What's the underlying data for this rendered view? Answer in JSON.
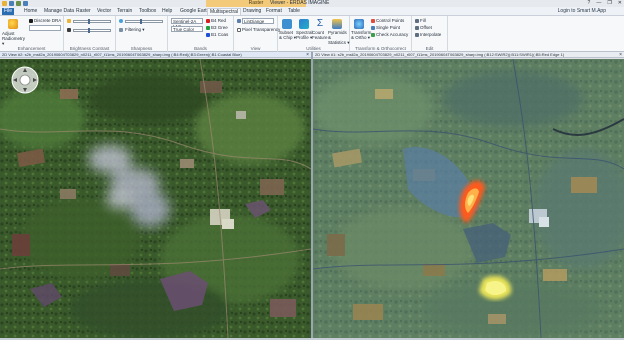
{
  "titlebar": {
    "context_group": "Raster",
    "title": "Viewer - ERDAS IMAGINE",
    "controls": [
      "?",
      "—",
      "❐",
      "✕"
    ]
  },
  "menu": {
    "items": [
      "File",
      "Home",
      "Manage Data",
      "Raster",
      "Vector",
      "Terrain",
      "Toolbox",
      "Help",
      "Google Earth",
      "Multispectral",
      "Drawing",
      "Format",
      "Table"
    ],
    "active": "Multispectral",
    "login": "Login to Smart M.App"
  },
  "ribbon": {
    "enhancement": {
      "label": "Enhancement",
      "adjust": "Adjust Radiometry ▾",
      "discrete_dra": "Discrete DRA"
    },
    "brightness": {
      "label": "Brightness Contrast"
    },
    "sharpness": {
      "label": "Sharpness",
      "filtering": "Filtering ▾"
    },
    "bands": {
      "label": "Bands",
      "sensor_combo": "Sentinel-2A L1C",
      "color_mode": "True Color",
      "r_band": "B4 Red",
      "g_band": "B3 Gree",
      "b_band": "B1 Coas"
    },
    "view": {
      "label": "View",
      "resample": "LinDiange",
      "pixel_transparency": "Pixel Transparency"
    },
    "utilities": {
      "label": "Utilities",
      "subset": "Subset & Chip ▾",
      "spectral": "Spectral Profile ▾",
      "count": "Count Feature",
      "pyramids": "Pyramids & Statistics ▾"
    },
    "transform": {
      "label": "Transform & Orthocorrect",
      "transform_ortho": "Transform & Ortho ▾",
      "control_points": "Control Points",
      "single_point": "Single Point",
      "check_accuracy": "Check Accuracy"
    },
    "edit": {
      "label": "Edit",
      "fill": "Fill",
      "offset": "Offset",
      "interpolate": "Interpolate"
    }
  },
  "views": {
    "left": {
      "header": "2D View #2: s2b_msil2a_20190604T03829_n0211_r007_t11ms_20190604T063829_sharp.img (:B4:Red)(:B3:Green)(:B1:Coastal Blue)"
    },
    "right": {
      "header": "2D View #1: s2b_msil2a_20190604T03829_n0211_r007_t11ms_20190604T063829_sharp.img (:B12:SWIR2)(:B11:SWIR1)(:B5:Red Edge 1)"
    }
  },
  "colors": {
    "file_tab": "#2b6cb3",
    "context_group": "#f3c97a",
    "ribbon_bg": "#f7f8fa",
    "fire_hotspot": "#ff5a1e",
    "vegetation_dark": "#2f4a23"
  }
}
